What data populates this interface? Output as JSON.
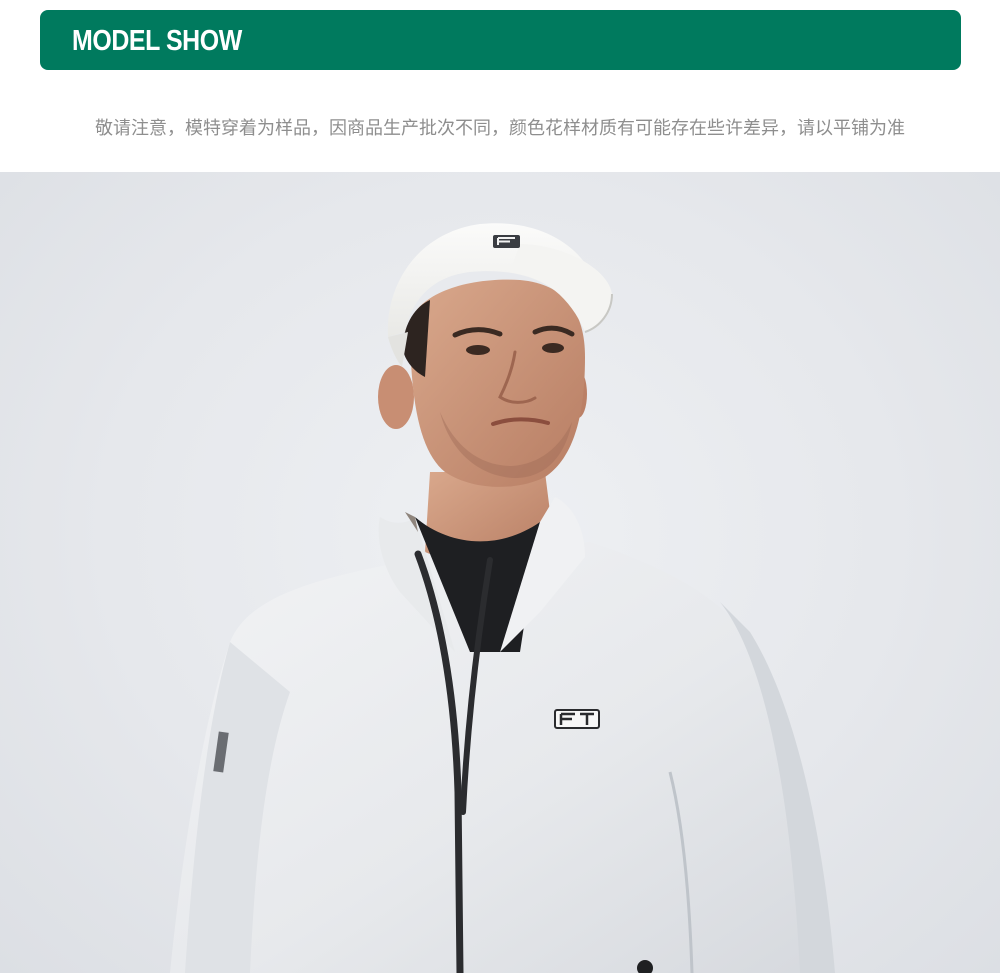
{
  "banner": {
    "title": "MODEL SHOW",
    "color": "#007a5e"
  },
  "notice": {
    "text": "敬请注意，模特穿着为样品，因商品生产批次不同，颜色花样材质有可能存在些许差异，请以平铺为准"
  },
  "model_photo": {
    "cap_logo_icon": "fila-f-logo-icon",
    "jacket_logo_icon": "fila-ft-logo-icon",
    "background_color": "#e6e8ec",
    "jacket_color": "#e9ebee",
    "cap_color": "#f6f6f4"
  }
}
